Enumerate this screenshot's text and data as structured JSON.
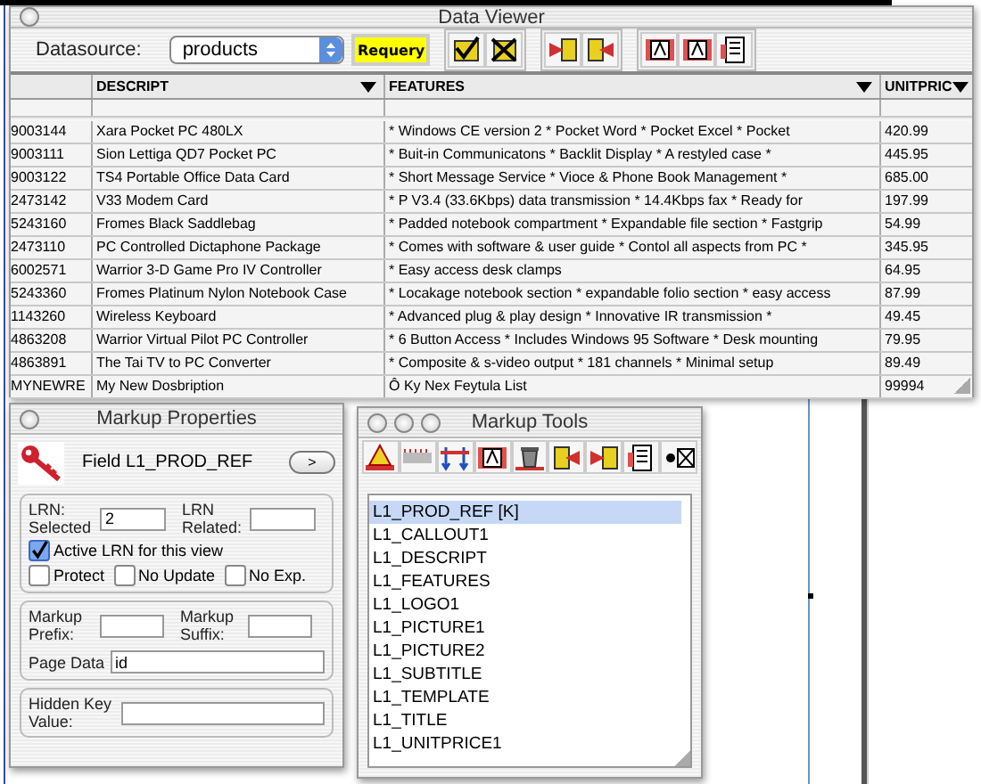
{
  "data_viewer": {
    "title": "Data Viewer",
    "datasource_label": "Datasource:",
    "datasource": "products",
    "requery_button": "Requery",
    "table": {
      "columns": [
        "",
        "DESCRIPT",
        "FEATURES",
        "UNITPRIC"
      ],
      "rows": [
        [
          "9003144",
          "Xara Pocket PC 480LX",
          "* Windows CE version 2 * Pocket Word * Pocket Excel * Pocket",
          "420.99"
        ],
        [
          "9003111",
          "Sion Lettiga QD7 Pocket PC",
          "* Buit-in Communicatons * Backlit Display * A restyled case *",
          "445.95"
        ],
        [
          "9003122",
          "TS4 Portable Office Data Card",
          "* Short Message Service * Vioce & Phone Book Management *",
          "685.00"
        ],
        [
          "2473142",
          "V33 Modem Card",
          "* P V3.4 (33.6Kbps) data transmission * 14.4Kbps fax * Ready for",
          "197.99"
        ],
        [
          "5243160",
          "Fromes Black Saddlebag",
          "*  Padded notebook compartment * Expandable file section * Fastgrip",
          "54.99"
        ],
        [
          "2473110",
          "PC Controlled Dictaphone Package",
          "* Comes with software & user guide * Contol all aspects from PC *",
          "345.95"
        ],
        [
          "6002571",
          "Warrior 3-D Game Pro IV Controller",
          "* Easy access desk clamps",
          "64.95"
        ],
        [
          "5243360",
          "Fromes Platinum Nylon Notebook Case",
          "* Locakage notebook section * expandable folio section * easy access",
          "87.99"
        ],
        [
          "1143260",
          "Wireless Keyboard",
          "* Advanced plug & play design * Innovative IR transmission *",
          "49.45"
        ],
        [
          "4863208",
          "Warrior Virtual Pilot PC Controller",
          "* 6 Button Access * Includes Windows 95 Software * Desk mounting",
          "79.95"
        ],
        [
          "4863891",
          "The Tai TV to PC Converter",
          "* Composite & s-video output * 181 channels * Minimal setup",
          "89.49"
        ],
        [
          "MYNEWRE",
          "My New Dosbription",
          "Ô Ky Nex Feytula List",
          "99994"
        ]
      ]
    }
  },
  "markup_properties": {
    "title": "Markup Properties",
    "field": "Field L1_PROD_REF",
    "next_button": ">",
    "lrn_selected": {
      "label": "LRN: Selected",
      "value": "2"
    },
    "lrn_related": {
      "label": "LRN Related:"
    },
    "checkboxes": [
      {
        "label": "Active LRN for this view",
        "checked": true
      },
      {
        "label": "Protect",
        "checked": false
      },
      {
        "label": "No Update",
        "checked": false
      },
      {
        "label": "No Exp.",
        "checked": false
      }
    ],
    "markup_prefix": {
      "label": "Markup Prefix:"
    },
    "markup_suffix": {
      "label": "Markup Suffix:"
    },
    "page_data": {
      "label": "Page Data",
      "value": "id"
    },
    "hidden_key_value": {
      "label": "Hidden Key Value:"
    }
  },
  "markup_tools": {
    "title": "Markup Tools",
    "items": [
      {
        "label": "L1_PROD_REF [K]",
        "selected": true
      },
      {
        "label": "L1_CALLOUT1",
        "selected": false
      },
      {
        "label": "L1_DESCRIPT",
        "selected": false
      },
      {
        "label": "L1_FEATURES",
        "selected": false
      },
      {
        "label": "L1_LOGO1",
        "selected": false
      },
      {
        "label": "L1_PICTURE1",
        "selected": false
      },
      {
        "label": "L1_PICTURE2",
        "selected": false
      },
      {
        "label": "L1_SUBTITLE",
        "selected": false
      },
      {
        "label": "L1_TEMPLATE",
        "selected": false
      },
      {
        "label": "L1_TITLE",
        "selected": false
      },
      {
        "label": "L1_UNITPRICE1",
        "selected": false
      }
    ]
  }
}
